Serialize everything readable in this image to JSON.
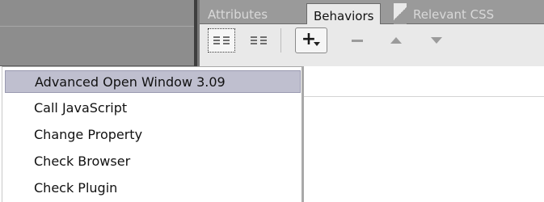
{
  "tabs": [
    {
      "label": "Attributes",
      "active": false
    },
    {
      "label": "Behaviors",
      "active": true
    },
    {
      "label": "Relevant CSS",
      "active": false
    }
  ],
  "toolbar": {
    "buttons": [
      {
        "name": "show-set-events",
        "icon": "list-icon"
      },
      {
        "name": "show-all-events",
        "icon": "list-icon"
      },
      {
        "name": "add-behavior",
        "icon": "plus-icon",
        "glyph": "+"
      },
      {
        "name": "remove-behavior",
        "icon": "minus-icon"
      },
      {
        "name": "move-up",
        "icon": "triangle-up-icon"
      },
      {
        "name": "move-down",
        "icon": "triangle-down-icon"
      }
    ]
  },
  "menu": {
    "items": [
      {
        "label": "Advanced Open Window 3.09",
        "highlighted": true
      },
      {
        "label": "Call JavaScript",
        "highlighted": false
      },
      {
        "label": "Change Property",
        "highlighted": false
      },
      {
        "label": "Check Browser",
        "highlighted": false
      },
      {
        "label": "Check Plugin",
        "highlighted": false
      }
    ]
  },
  "colors": {
    "highlight": "#bfbfcf",
    "panel_gray": "#8d8d8d",
    "toolbar_bg": "#e9e9e9"
  }
}
